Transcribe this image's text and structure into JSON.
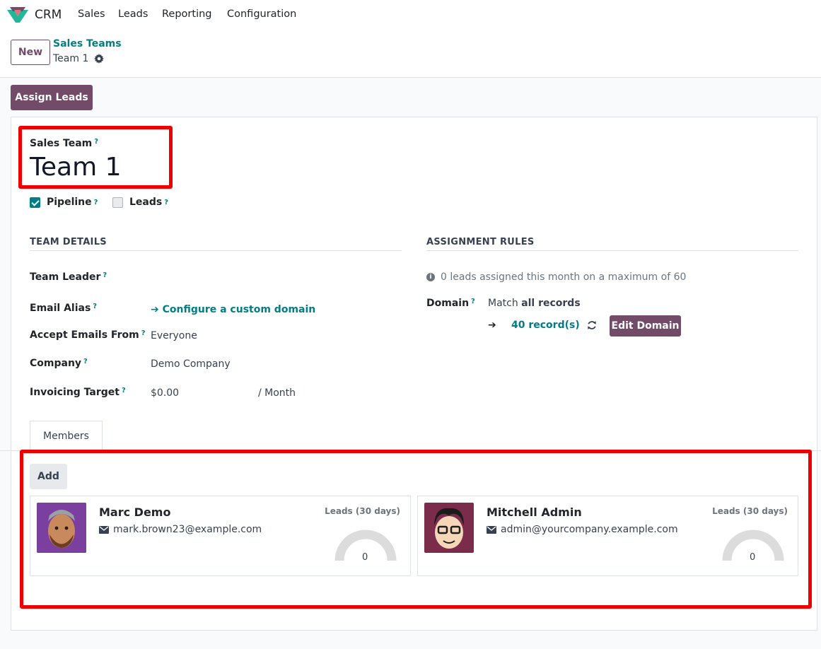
{
  "app": {
    "name": "CRM",
    "menu": [
      "Sales",
      "Leads",
      "Reporting",
      "Configuration"
    ]
  },
  "control": {
    "new_label": "New",
    "breadcrumb_parent": "Sales Teams",
    "breadcrumb_current": "Team 1"
  },
  "statusbar": {
    "assign_label": "Assign Leads"
  },
  "form": {
    "title_label": "Sales Team",
    "title_value": "Team 1",
    "help_mark": "?",
    "pipeline_label": "Pipeline",
    "pipeline_checked": true,
    "leads_label": "Leads",
    "leads_checked": false
  },
  "team_details": {
    "heading": "TEAM DETAILS",
    "team_leader_label": "Team Leader",
    "team_leader_value": "",
    "email_alias_label": "Email Alias",
    "email_alias_link": "Configure a custom domain",
    "accept_from_label": "Accept Emails From",
    "accept_from_value": "Everyone",
    "company_label": "Company",
    "company_value": "Demo Company",
    "invoicing_label": "Invoicing Target",
    "invoicing_value": "$0.00",
    "invoicing_unit": "/ Month"
  },
  "assignment": {
    "heading": "ASSIGNMENT RULES",
    "info_text": "0 leads assigned this month on a maximum of 60",
    "domain_label": "Domain",
    "domain_match_prefix": "Match",
    "domain_match_bold": "all records",
    "records_link": "40 record(s)",
    "edit_domain_label": "Edit Domain"
  },
  "tabs": {
    "members_label": "Members"
  },
  "members": {
    "add_label": "Add",
    "leads_header": "Leads (30 days)",
    "cards": [
      {
        "name": "Marc Demo",
        "email": "mark.brown23@example.com",
        "leads": "0",
        "leads_fraction": 0
      },
      {
        "name": "Mitchell Admin",
        "email": "admin@yourcompany.example.com",
        "leads": "0",
        "leads_fraction": 0
      }
    ]
  },
  "colors": {
    "primary": "#714b67",
    "teal": "#017e84",
    "highlight": "#ee0000"
  }
}
